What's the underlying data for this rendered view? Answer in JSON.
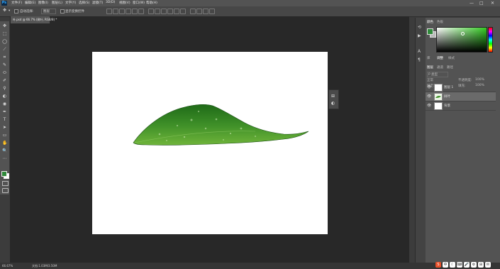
{
  "app": {
    "logo": "Ps"
  },
  "menubar": {
    "items": [
      "文件(F)",
      "编辑(E)",
      "图像(I)",
      "图层(L)",
      "文字(Y)",
      "选择(S)",
      "滤镜(T)",
      "3D(D)",
      "视图(V)",
      "窗口(W)",
      "帮助(H)"
    ],
    "minimize": "—",
    "maximize": "□",
    "close": "✕"
  },
  "options": {
    "auto_select_label": "自动选择:",
    "auto_select_value": "图层",
    "show_transform_label": "显示变换控件"
  },
  "document": {
    "tab_label": "叶.psd @ 66.7% (树叶, RGB/8) *"
  },
  "tools": [
    "✥",
    "⬚",
    "◯",
    "⟋",
    "⌗",
    "✎",
    "⬭",
    "✐",
    "⚲",
    "◐",
    "◉",
    "✒",
    "T",
    "➤",
    "▭",
    "✋",
    "🔍",
    "⋯"
  ],
  "right_panel": {
    "color_tabs": [
      "颜色",
      "色板"
    ],
    "adjust_tabs": [
      "库",
      "调整",
      "样式"
    ],
    "layer_tabs": [
      "图层",
      "通道",
      "路径"
    ],
    "layer_filter": "P 类型",
    "blend_mode": "正常",
    "opacity_label": "不透明度:",
    "opacity_value": "100%",
    "lock_label": "锁定:",
    "fill_label": "填充:",
    "fill_value": "100%",
    "layers": [
      {
        "name": "图层 1",
        "selected": false
      },
      {
        "name": "树叶",
        "selected": true
      },
      {
        "name": "背景",
        "selected": false
      }
    ]
  },
  "status": {
    "zoom": "66.67%",
    "doc_info": "文档:1.03M/3.50M"
  },
  "taskbar": [
    "S",
    "中",
    "☾",
    "⌨",
    "🎤",
    "⚙",
    "⊞",
    "✉"
  ],
  "colors": {
    "leaf": "#3e8f28",
    "ps_blue": "#31a8ff",
    "foreground": "#2f8a3a"
  }
}
